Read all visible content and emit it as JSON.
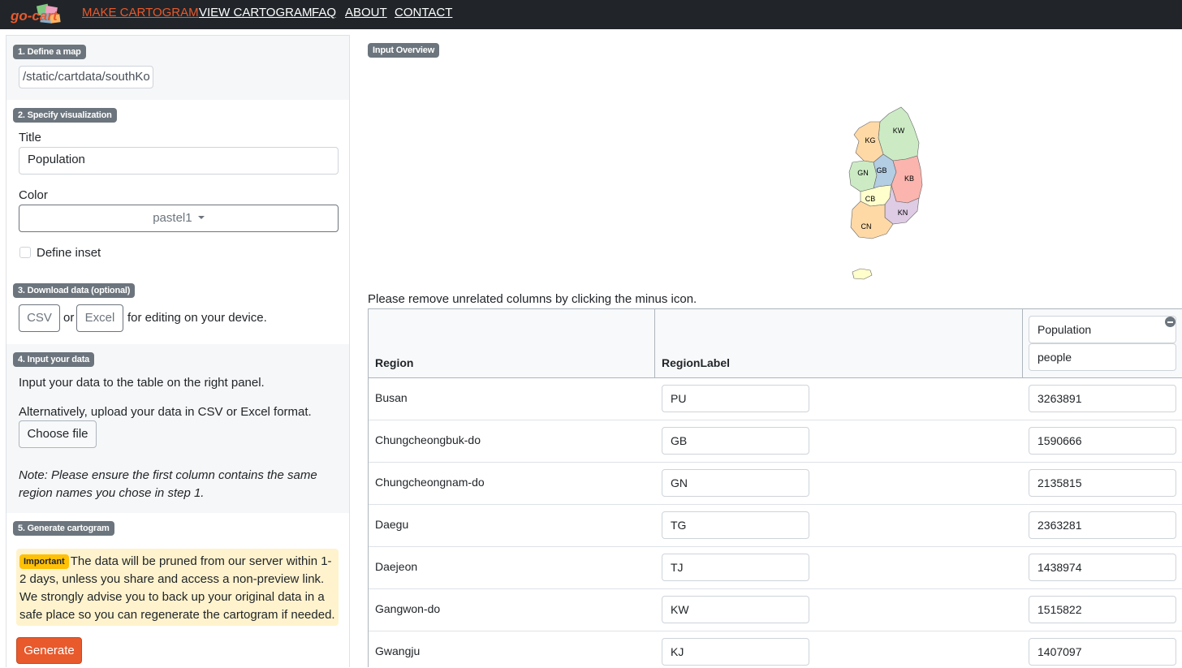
{
  "nav": {
    "logo_text": "go-cart",
    "links": [
      "MAKE CARTOGRAM",
      "VIEW CARTOGRAM",
      "FAQ",
      "ABOUT",
      "CONTACT"
    ]
  },
  "left": {
    "step1": {
      "badge": "1. Define a map",
      "map_path": "/static/cartdata/southKo"
    },
    "step2": {
      "badge": "2. Specify visualization",
      "title_label": "Title",
      "title_value": "Population",
      "color_label": "Color",
      "color_value": "pastel1",
      "inset_label": "Define inset"
    },
    "step3": {
      "badge": "3. Download data (optional)",
      "csv": "CSV",
      "or": "or",
      "excel": "Excel",
      "suffix": "for editing on your device."
    },
    "step4": {
      "badge": "4. Input your data",
      "line1": "Input your data to the table on the right panel.",
      "line2": "Alternatively, upload your data in CSV or Excel format.",
      "choose_file": "Choose file",
      "note_line1": "Note: Please ensure the first column contains the same",
      "note_line2": "region names you chose in step 1."
    },
    "step5": {
      "badge": "5. Generate cartogram",
      "important": "Important",
      "alert_text": "The data will be pruned from our server within 1-2 days, unless you share and access a non-preview link. We strongly advise you to back up your original data in a safe place so you can regenerate the cartogram if needed.",
      "generate": "Generate"
    }
  },
  "right": {
    "overview_badge": "Input Overview",
    "map_labels": [
      "KW",
      "KG",
      "GN",
      "GB",
      "KB",
      "CB",
      "KN",
      "CN"
    ],
    "instruction": "Please remove unrelated columns by clicking the minus icon.",
    "table": {
      "headers": [
        "Region",
        "RegionLabel"
      ],
      "value_column": {
        "name": "Population",
        "unit": "people"
      },
      "rows": [
        {
          "region": "Busan",
          "label": "PU",
          "value": "3263891"
        },
        {
          "region": "Chungcheongbuk-do",
          "label": "GB",
          "value": "1590666"
        },
        {
          "region": "Chungcheongnam-do",
          "label": "GN",
          "value": "2135815"
        },
        {
          "region": "Daegu",
          "label": "TG",
          "value": "2363281"
        },
        {
          "region": "Daejeon",
          "label": "TJ",
          "value": "1438974"
        },
        {
          "region": "Gangwon-do",
          "label": "KW",
          "value": "1515822"
        },
        {
          "region": "Gwangju",
          "label": "KJ",
          "value": "1407097"
        }
      ]
    }
  },
  "colors": {
    "navbar": "#212529",
    "accent": "#e8592c",
    "badge": "#6c757d",
    "warning": "#ffc107",
    "alert_bg": "#fff3cd",
    "map_regions": {
      "KW": "#ccebc5",
      "KG": "#fed9a6",
      "GN": "#ccebc5",
      "GB": "#b3cde3",
      "KB": "#fbb4ae",
      "CB": "#ffffcc",
      "KN": "#decbe4",
      "CN": "#fed9a6",
      "jeju": "#ffffcc"
    }
  }
}
